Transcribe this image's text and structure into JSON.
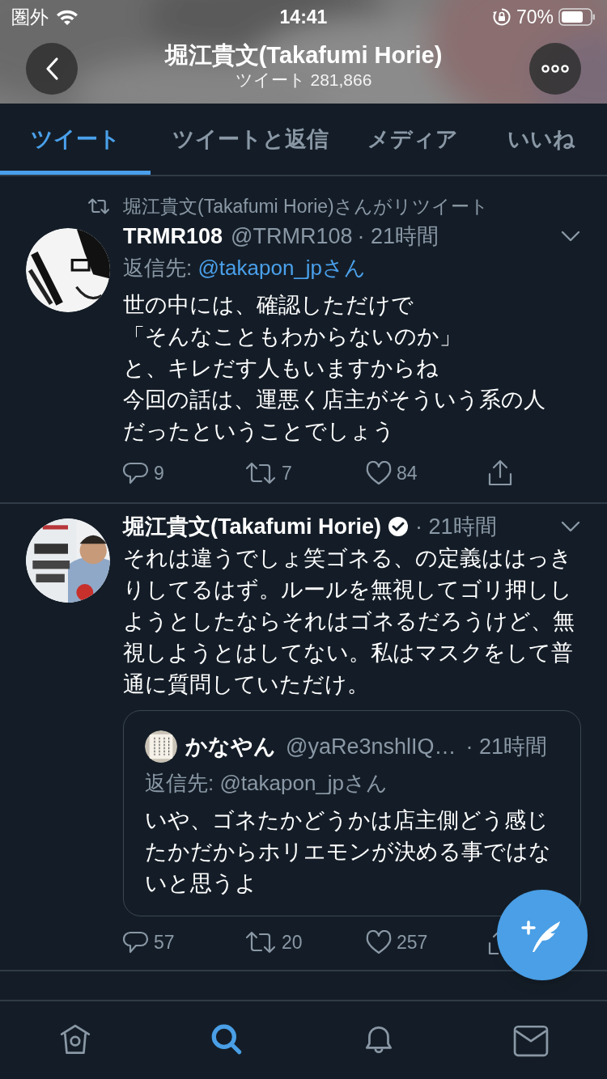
{
  "status_bar": {
    "carrier": "圏外",
    "time": "14:41",
    "battery": "70%"
  },
  "header": {
    "title": "堀江貴文(Takafumi Horie)",
    "subtitle": "ツイート 281,866"
  },
  "tabs": [
    {
      "label": "ツイート",
      "selected": true
    },
    {
      "label": "ツイートと返信",
      "selected": false
    },
    {
      "label": "メディア",
      "selected": false
    },
    {
      "label": "いいね",
      "selected": false
    }
  ],
  "tweets": [
    {
      "retweeted_by": "堀江貴文(Takafumi Horie)さんがリツイート",
      "name": "TRMR108",
      "verified": false,
      "handle": "@TRMR108",
      "time": "· 21時間",
      "reply_label": "返信先: ",
      "reply_to": "@takapon_jpさん",
      "lines": [
        "世の中には、確認しただけで",
        "「そんなこともわからないのか」",
        "と、キレだす人もいますからね",
        "今回の話は、運悪く店主がそういう系の人",
        "だったということでしょう"
      ],
      "replies": "9",
      "retweets": "7",
      "likes": "84"
    },
    {
      "name": "堀江貴文(Takafumi Horie)",
      "verified": true,
      "time": "· 21時間",
      "text": "それは違うでしょ笑ゴネる、の定義ははっきりしてるはず。ルールを無視してゴリ押ししようとしたならそれはゴネるだろうけど、無視しようとはしてない。私はマスクをして普通に質問していただけ。",
      "quote": {
        "name": "かなやん",
        "handle": "@yaRe3nshlIQ…",
        "time": "· 21時間",
        "reply": "返信先: @takapon_jpさん",
        "text": "いや、ゴネたかどうかは店主側どう感じたかだからホリエモンが決める事ではないと思うよ"
      },
      "replies": "57",
      "retweets": "20",
      "likes": "257"
    }
  ],
  "nav": [
    {
      "kind": "home",
      "selected": false
    },
    {
      "kind": "search",
      "selected": true
    },
    {
      "kind": "bell",
      "selected": false
    },
    {
      "kind": "mail",
      "selected": false
    }
  ]
}
